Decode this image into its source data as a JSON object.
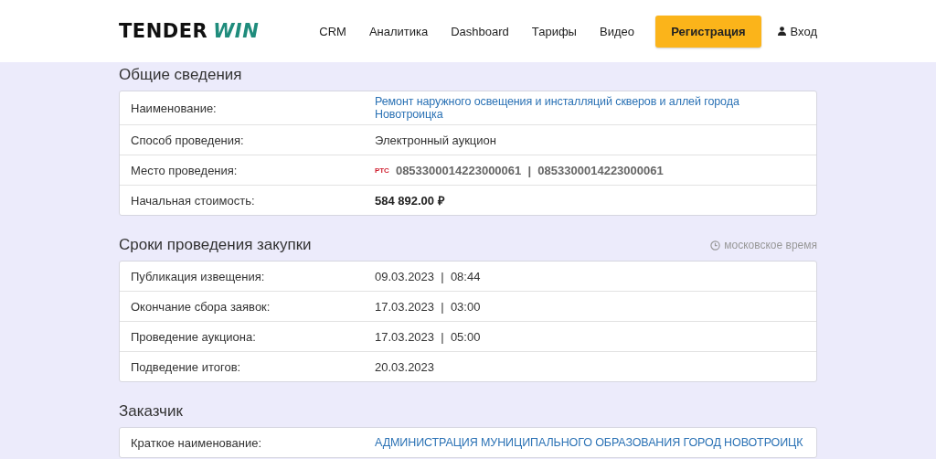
{
  "header": {
    "logo": {
      "first": "TENDER",
      "second": "WIN"
    },
    "nav": [
      {
        "label": "CRM"
      },
      {
        "label": "Аналитика"
      },
      {
        "label": "Dashboard"
      },
      {
        "label": "Тарифы"
      },
      {
        "label": "Видео"
      }
    ],
    "register_button": "Регистрация",
    "login": "Вход"
  },
  "sections": [
    {
      "title": "Общие сведения",
      "rows": [
        {
          "label": "Наименование:",
          "kind": "link",
          "value": "Ремонт наружного освещения и инсталляций скверов и аллей города Новотроицка"
        },
        {
          "label": "Способ проведения:",
          "kind": "text",
          "value": "Электронный аукцион"
        },
        {
          "label": "Место проведения:",
          "kind": "platform",
          "badge": "РТС",
          "value": "0853300014223000061  |  0853300014223000061"
        },
        {
          "label": "Начальная стоимость:",
          "kind": "bold",
          "value": "584 892.00 ₽"
        }
      ]
    },
    {
      "title": "Сроки проведения закупки",
      "note": "московское время",
      "rows": [
        {
          "label": "Публикация извещения:",
          "kind": "text",
          "value": "09.03.2023  |  08:44"
        },
        {
          "label": "Окончание сбора заявок:",
          "kind": "text",
          "value": "17.03.2023  |  03:00"
        },
        {
          "label": "Проведение аукциона:",
          "kind": "text",
          "value": "17.03.2023  |  05:00"
        },
        {
          "label": "Подведение итогов:",
          "kind": "text",
          "value": "20.03.2023"
        }
      ]
    },
    {
      "title": "Заказчик",
      "rows": [
        {
          "label": "Краткое наименование:",
          "kind": "link",
          "value": "АДМИНИСТРАЦИЯ МУНИЦИПАЛЬНОГО ОБРАЗОВАНИЯ ГОРОД НОВОТРОИЦК"
        }
      ]
    }
  ]
}
